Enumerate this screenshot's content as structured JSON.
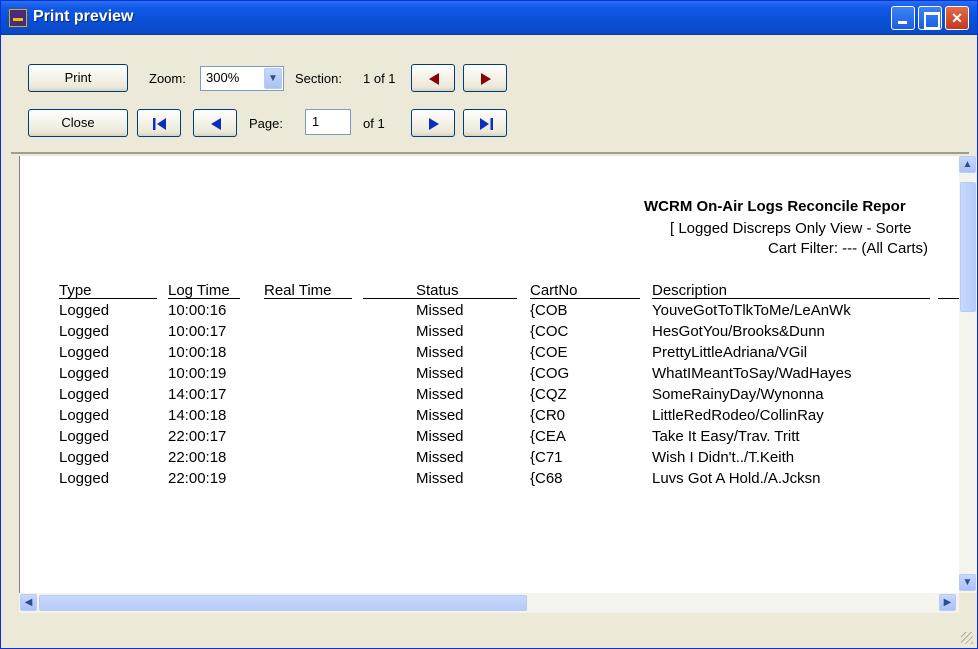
{
  "window": {
    "title": "Print preview"
  },
  "toolbar": {
    "print_label": "Print",
    "close_label": "Close",
    "zoom_label": "Zoom:",
    "zoom_value": "300%",
    "section_label": "Section:",
    "section_value": "1 of 1",
    "page_label": "Page:",
    "page_value": "1",
    "page_of": "of 1"
  },
  "colors": {
    "nav_arrow": "#0a2fbf",
    "section_arrow": "#8b0000",
    "title_bar": "#0a4fd6"
  },
  "report": {
    "title": "WCRM On-Air Logs Reconcile Repor",
    "subtitle": "[ Logged Discreps Only View - Sorte",
    "filter": "Cart Filter: --- (All Carts)",
    "columns": [
      "Type",
      "Log Time",
      "Real Time",
      "Status",
      "CartNo",
      "Description"
    ],
    "rows": [
      [
        "Logged",
        "10:00:16",
        "",
        "Missed",
        "{COB",
        "YouveGotToTlkToMe/LeAnWk"
      ],
      [
        "Logged",
        "10:00:17",
        "",
        "Missed",
        "{COC",
        "HesGotYou/Brooks&Dunn"
      ],
      [
        "Logged",
        "10:00:18",
        "",
        "Missed",
        "{COE",
        "PrettyLittleAdriana/VGil"
      ],
      [
        "Logged",
        "10:00:19",
        "",
        "Missed",
        "{COG",
        "WhatIMeantToSay/WadHayes"
      ],
      [
        "Logged",
        "14:00:17",
        "",
        "Missed",
        "{CQZ",
        "SomeRainyDay/Wynonna"
      ],
      [
        "Logged",
        "14:00:18",
        "",
        "Missed",
        "{CR0",
        "LittleRedRodeo/CollinRay"
      ],
      [
        "Logged",
        "22:00:17",
        "",
        "Missed",
        "{CEA",
        "Take It Easy/Trav. Tritt"
      ],
      [
        "Logged",
        "22:00:18",
        "",
        "Missed",
        "{C71",
        "Wish I Didn't../T.Keith"
      ],
      [
        "Logged",
        "22:00:19",
        "",
        "Missed",
        "{C68",
        "Luvs Got A Hold./A.Jcksn"
      ]
    ]
  }
}
